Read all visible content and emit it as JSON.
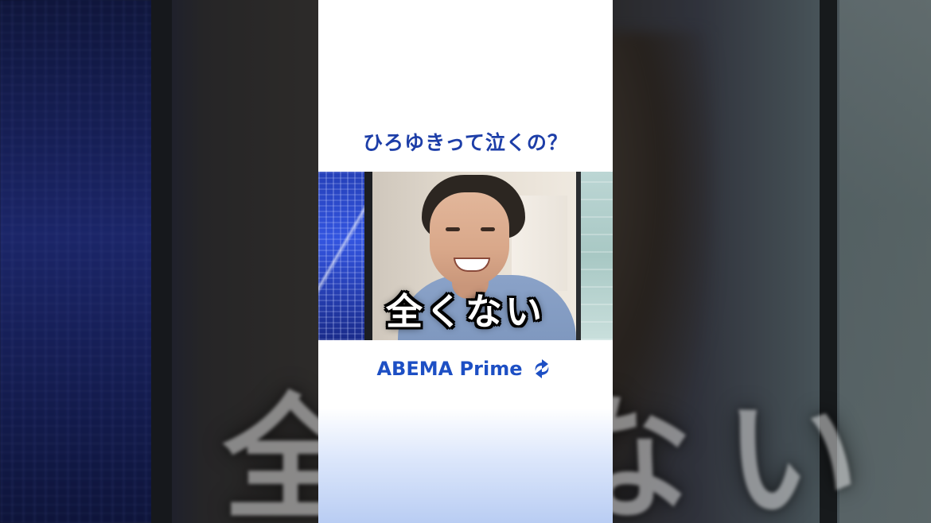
{
  "video_title": "ひろゆきって泣くの？",
  "subtitle": "全くない",
  "background_subtitle": "全くない",
  "brand": {
    "name": "ABEMA Prime",
    "icon": "refresh-loop-icon",
    "color": "#1d4fc4"
  },
  "colors": {
    "title": "#1d3ea8",
    "panel_background": "#ffffff"
  }
}
